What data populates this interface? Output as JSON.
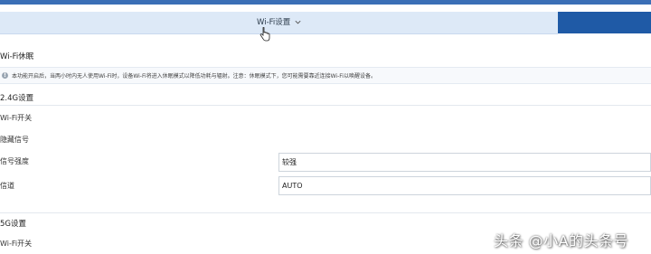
{
  "header": {
    "wifi_settings_tab": "Wi-Fi设置"
  },
  "wifi_sleep": {
    "title": "Wi-Fi休眠",
    "notice": "本功能开启后，当两小时内无人使用Wi-Fi时，设备Wi-Fi将进入休眠模式以降低功耗与辐射。注意：休眠模式下，您可能需要靠近连接Wi-Fi以唤醒设备。"
  },
  "band_24g": {
    "title": "2.4G设置",
    "wifi_switch_label": "Wi-Fi开关",
    "hidden_ssid_label": "隐藏信号",
    "signal_strength_label": "信号强度",
    "signal_strength_value": "较强",
    "channel_label": "信道",
    "channel_value": "AUTO"
  },
  "band_5g": {
    "title": "5G设置",
    "wifi_switch_label": "Wi-Fi开关"
  },
  "watermark": "头条 @小A的头条号",
  "colors": {
    "topbar": "#3b6fb6",
    "tab_bg": "#dde9f7",
    "active_tab": "#1f5aa6"
  }
}
